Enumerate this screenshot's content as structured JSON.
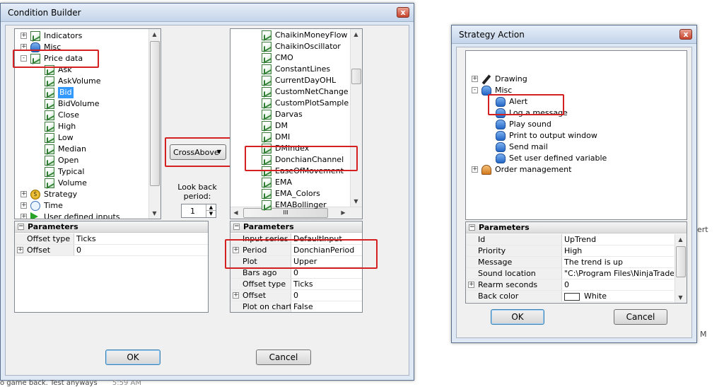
{
  "condition_builder": {
    "title": "Condition Builder",
    "close_glyph": "x",
    "left_tree": {
      "items": [
        {
          "label": "Indicators",
          "toggle": "+",
          "icon": "chart-icon"
        },
        {
          "label": "Misc",
          "toggle": "+",
          "icon": "database-icon"
        },
        {
          "label": "Price data",
          "toggle": "-",
          "icon": "chart-icon"
        },
        {
          "label": "Ask",
          "icon": "chart-icon"
        },
        {
          "label": "AskVolume",
          "icon": "chart-icon"
        },
        {
          "label": "Bid",
          "icon": "chart-icon",
          "selected": true
        },
        {
          "label": "BidVolume",
          "icon": "chart-icon"
        },
        {
          "label": "Close",
          "icon": "chart-icon"
        },
        {
          "label": "High",
          "icon": "chart-icon"
        },
        {
          "label": "Low",
          "icon": "chart-icon"
        },
        {
          "label": "Median",
          "icon": "chart-icon"
        },
        {
          "label": "Open",
          "icon": "chart-icon"
        },
        {
          "label": "Typical",
          "icon": "chart-icon"
        },
        {
          "label": "Volume",
          "icon": "chart-icon"
        },
        {
          "label": "Strategy",
          "toggle": "+",
          "icon": "dollar-icon"
        },
        {
          "label": "Time",
          "toggle": "+",
          "icon": "clock-icon"
        },
        {
          "label": "User defined inputs",
          "toggle": "+",
          "icon": "play-icon"
        }
      ]
    },
    "left_params": {
      "header": "Parameters",
      "rows": [
        {
          "name": "Offset type",
          "value": "Ticks"
        },
        {
          "name": "Offset",
          "value": "0",
          "expand": "+"
        }
      ]
    },
    "operator": {
      "value": "CrossAbove",
      "arrow": "▼"
    },
    "lookback": {
      "label_line1": "Look back",
      "label_line2": "period:",
      "value": "1"
    },
    "right_list": {
      "items": [
        "ChaikinMoneyFlow",
        "ChaikinOscillator",
        "CMO",
        "ConstantLines",
        "CurrentDayOHL",
        "CustomNetChange",
        "CustomPlotSample",
        "Darvas",
        "DM",
        "DMI",
        "DMIndex",
        "DonchianChannel",
        "EaseOfMovement",
        "EMA",
        "EMA_Colors",
        "EMABollinger"
      ],
      "hscroll_grip": "III"
    },
    "right_params": {
      "header": "Parameters",
      "rows": [
        {
          "name": "Input series",
          "value": "DefaultInput"
        },
        {
          "name": "Period",
          "value": "DonchianPeriod",
          "expand": "+"
        },
        {
          "name": "Plot",
          "value": "Upper"
        },
        {
          "name": "Bars ago",
          "value": "0"
        },
        {
          "name": "Offset type",
          "value": "Ticks"
        },
        {
          "name": "Offset",
          "value": "0",
          "expand": "+"
        },
        {
          "name": "Plot on chart",
          "value": "False"
        }
      ]
    },
    "ok_label": "OK",
    "cancel_label": "Cancel"
  },
  "strategy_action": {
    "title": "Strategy Action",
    "close_glyph": "x",
    "tree": {
      "items": [
        {
          "label": "Drawing",
          "toggle": "+",
          "icon": "pen-icon"
        },
        {
          "label": "Misc",
          "toggle": "-",
          "icon": "database-icon"
        },
        {
          "label": "Alert",
          "icon": "database-icon"
        },
        {
          "label": "Log a message",
          "icon": "database-icon"
        },
        {
          "label": "Play sound",
          "icon": "database-icon"
        },
        {
          "label": "Print to output window",
          "icon": "database-icon"
        },
        {
          "label": "Send mail",
          "icon": "database-icon"
        },
        {
          "label": "Set user defined variable",
          "icon": "database-icon"
        },
        {
          "label": "Order management",
          "toggle": "+",
          "icon": "person-icon"
        }
      ]
    },
    "params": {
      "header": "Parameters",
      "rows": [
        {
          "name": "Id",
          "value": "UpTrend"
        },
        {
          "name": "Priority",
          "value": "High"
        },
        {
          "name": "Message",
          "value": "The trend is up"
        },
        {
          "name": "Sound location",
          "value": "\"C:\\Program Files\\NinjaTrader"
        },
        {
          "name": "Rearm seconds",
          "value": "0",
          "expand": "+"
        },
        {
          "name": "Back color",
          "value": "White",
          "swatch": "#ffffff"
        }
      ]
    },
    "ok_label": "OK",
    "cancel_label": "Cancel"
  },
  "background": {
    "status_text": "o game back. Test anyways",
    "status_time": "5:59 AM",
    "peek_ert": "ert",
    "peek_m": "M"
  },
  "colors": {
    "highlight": "#d42020",
    "selection": "#3399ff"
  }
}
